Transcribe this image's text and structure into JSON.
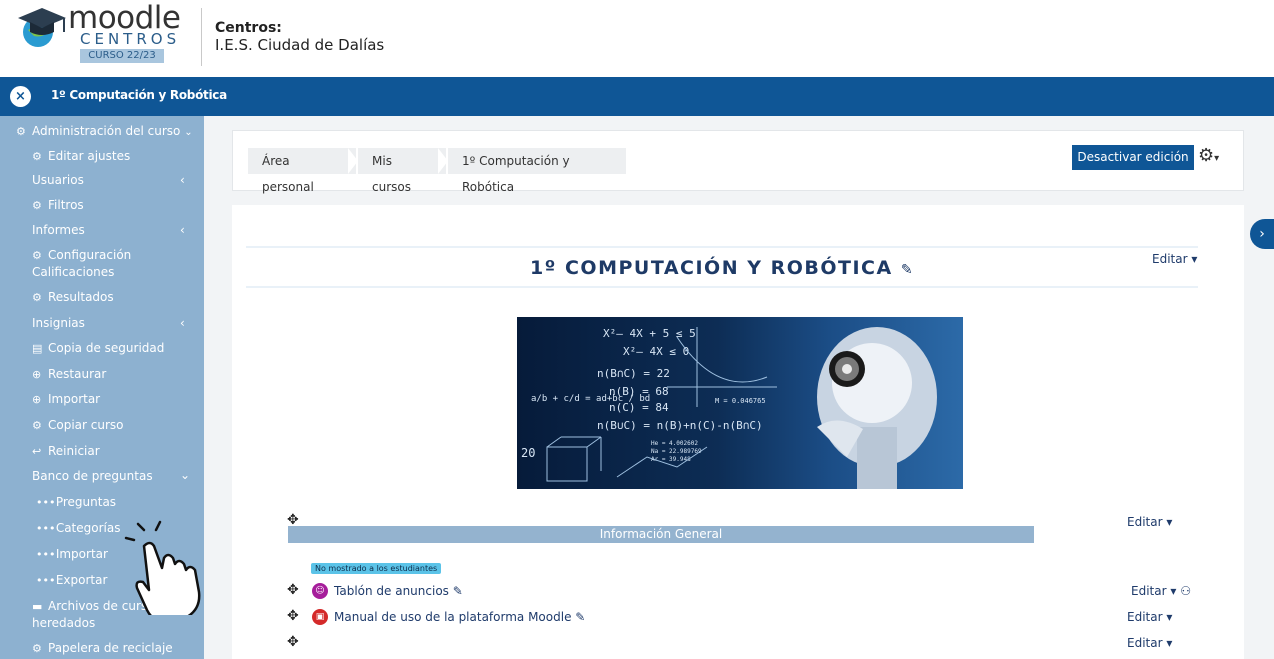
{
  "header": {
    "logo_word": "moodle",
    "logo_centros": "CENTROS",
    "logo_curso": "CURSO 22/23",
    "centro_label": "Centros:",
    "centro_name": "I.E.S. Ciudad de Dalías"
  },
  "navbar": {
    "close_symbol": "×",
    "course_name": "1º Computación y Robótica"
  },
  "sidebar": {
    "items": [
      {
        "label": "Administración del curso",
        "icon": "gears-icon"
      },
      {
        "label": "Editar ajustes",
        "icon": "gears-icon"
      },
      {
        "label": "Usuarios",
        "icon": ""
      },
      {
        "label": "Filtros",
        "icon": "gears-icon"
      },
      {
        "label": "Informes",
        "icon": ""
      },
      {
        "label": "Configuración Calificaciones",
        "icon": "gears-icon"
      },
      {
        "label": "Resultados",
        "icon": "gears-icon"
      },
      {
        "label": "Insignias",
        "icon": ""
      },
      {
        "label": "Copia de seguridad",
        "icon": "backup-icon"
      },
      {
        "label": "Restaurar",
        "icon": "upload-icon"
      },
      {
        "label": "Importar",
        "icon": "upload-icon"
      },
      {
        "label": "Copiar curso",
        "icon": "gears-icon"
      },
      {
        "label": "Reiniciar",
        "icon": "reply-icon"
      },
      {
        "label": "Banco de preguntas",
        "icon": ""
      },
      {
        "label": "Preguntas",
        "icon": "dots-icon"
      },
      {
        "label": "Categorías",
        "icon": "dots-icon"
      },
      {
        "label": "Importar",
        "icon": "dots-icon"
      },
      {
        "label": "Exportar",
        "icon": "dots-icon"
      },
      {
        "label": "Archivos de curso heredados",
        "icon": "folder-icon"
      },
      {
        "label": "Papelera de reciclaje",
        "icon": "gears-icon"
      }
    ]
  },
  "breadcrumb": [
    "Área personal",
    "Mis cursos",
    "1º Computación y Robótica"
  ],
  "toolbar": {
    "desactivar_label": "Desactivar edición"
  },
  "course": {
    "title": "1º COMPUTACIÓN Y ROBÓTICA"
  },
  "editar_label": "Editar",
  "banner": {
    "formula_1": "X²– 4X + 5 ≤ 5",
    "formula_2": "X²– 4X ≤ 0",
    "formula_3": "n(B∩C) = 22",
    "formula_4": "n(B) = 68",
    "formula_5": "n(C) = 84",
    "formula_6": "n(B∪C) = n(B)+n(C)-n(B∩C)",
    "formula_7": "a/b + c/d = ad+bc / bd",
    "formula_8": "M = 0.046765",
    "formula_9": "He = 4.002602",
    "formula_10": "Na = 22.989769",
    "formula_11": "Ar = 39.948",
    "formula_12": "20"
  },
  "section": {
    "name": "Información General"
  },
  "hidden_badge": "No mostrado a los estudiantes",
  "activities": [
    {
      "name": "Tablón de anuncios",
      "icon": "forum-icon",
      "color": "#a61e9b"
    },
    {
      "name": "Manual de uso de la plataforma Moodle",
      "icon": "pdf-icon",
      "color": "#d42a2a"
    }
  ],
  "colors": {
    "brand": "#0f5696",
    "sidebar": "#8db1d0",
    "section": "#94b3cf"
  }
}
